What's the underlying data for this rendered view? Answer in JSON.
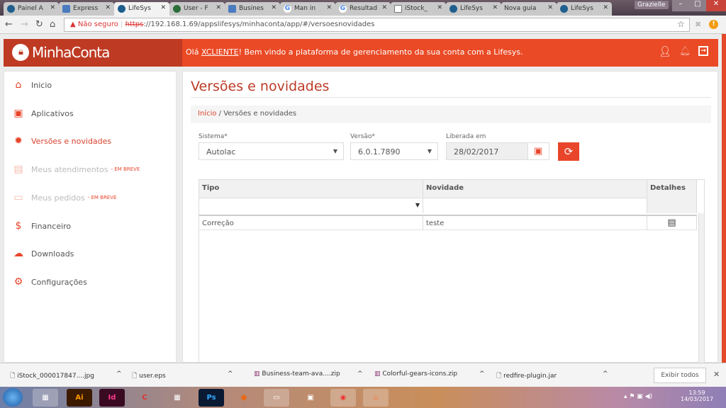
{
  "browser": {
    "tabs": [
      "Painel A",
      "Express",
      "LifeSys",
      "User - F",
      "Busines",
      "Man in",
      "Resultad",
      "iStock_",
      "LifeSys",
      "Nova guia",
      "LifeSys"
    ],
    "active_tab": 2,
    "user": "Grazielle",
    "security": "Não seguro",
    "url_scheme": "https",
    "url_rest": "://192.168.1.69/appslifesys/minhaconta/app/#/versoesnovidades"
  },
  "header": {
    "logo": "MinhaConta",
    "greeting_pre": "Olá ",
    "client": "XCLIENTE",
    "greeting_post": "! Bem vindo a plataforma de gerenciamento da sua conta com a Lifesys.",
    "brand_color": "#ea4a25"
  },
  "sidebar": {
    "items": [
      {
        "label": "Inicio",
        "icon": "home-icon",
        "state": "normal"
      },
      {
        "label": "Aplicativos",
        "icon": "calendar-icon",
        "state": "normal"
      },
      {
        "label": "Versões e novidades",
        "icon": "alert-badge-icon",
        "state": "active"
      },
      {
        "label": "Meus atendimentos",
        "icon": "chat-icon",
        "state": "disabled",
        "badge": "- EM BREVE"
      },
      {
        "label": "Meus pedidos",
        "icon": "clipboard-icon",
        "state": "disabled",
        "badge": "- EM BREVE"
      },
      {
        "label": "Financeiro",
        "icon": "dollar-icon",
        "state": "normal"
      },
      {
        "label": "Downloads",
        "icon": "cloud-download-icon",
        "state": "normal"
      },
      {
        "label": "Configurações",
        "icon": "gear-icon",
        "state": "normal"
      }
    ]
  },
  "main": {
    "title": "Versões e novidades",
    "breadcrumb": {
      "home": "Início",
      "sep": "/",
      "current": "Versões e novidades"
    },
    "form": {
      "sistema_label": "Sistema*",
      "sistema_value": "Autolac",
      "versao_label": "Versão*",
      "versao_value": "6.0.1.7890",
      "liberada_label": "Liberada em",
      "liberada_value": "28/02/2017"
    },
    "grid": {
      "columns": [
        "Tipo",
        "Novidade",
        "Detalhes"
      ],
      "rows": [
        {
          "tipo": "Correção",
          "novidade": "teste"
        }
      ]
    }
  },
  "downloads": {
    "items": [
      "iStock_000017847....jpg",
      "user.eps",
      "Business-team-ava....zip",
      "Colorful-gears-icons.zip",
      "redfire-plugin.jar"
    ],
    "show_all": "Exibir todos"
  },
  "taskbar": {
    "apps": [
      "Ai",
      "Id",
      "Ps"
    ],
    "time": "13:59",
    "date": "14/03/2017"
  }
}
